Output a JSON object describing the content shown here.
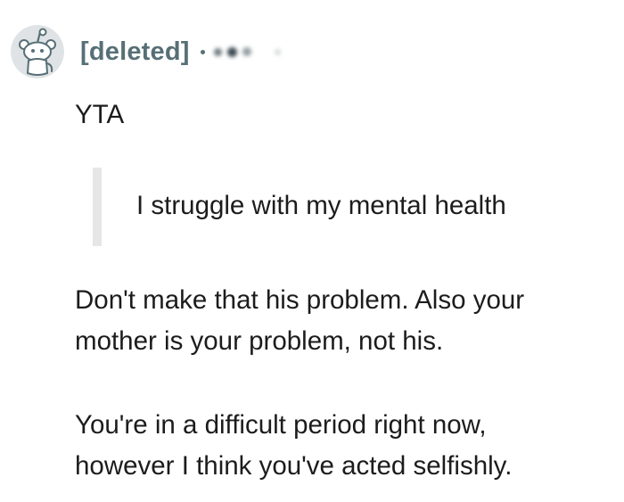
{
  "comment": {
    "author": "[deleted]",
    "separator": "·",
    "timestamp_obscured": true,
    "avatar_icon": "snoo-avatar-icon",
    "verdict": "YTA",
    "quote": "I struggle with my mental health",
    "paragraphs": [
      {
        "lines": [
          "Don't make that his problem. Also your",
          "mother is your problem, not his."
        ]
      },
      {
        "lines": [
          "You're in a difficult period right now,",
          "however I think you've acted selfishly."
        ]
      }
    ]
  },
  "colors": {
    "username": "#576f76",
    "text": "#1c1c1c",
    "quote_bar": "#e6e6e6",
    "background": "#ffffff"
  }
}
